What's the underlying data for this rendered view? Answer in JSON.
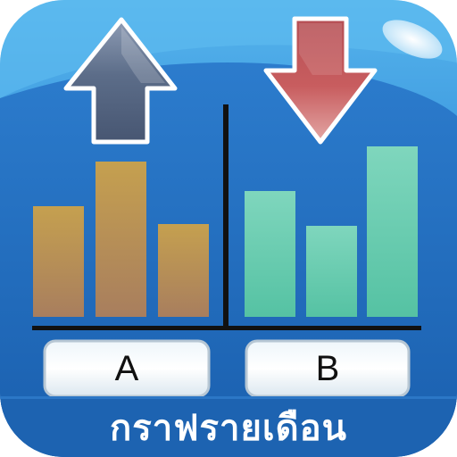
{
  "icon": {
    "caption": "กราฟรายเดือน",
    "group_a_label": "A",
    "group_b_label": "B",
    "arrow_up_name": "arrow-up-icon",
    "arrow_down_name": "arrow-down-icon"
  },
  "colors": {
    "background_light": "#3c9be0",
    "background_dark": "#1462b5",
    "caption_band": "#1c67b8",
    "group_a_bars": "#b98a55",
    "group_b_bars": "#6fd0b3",
    "arrow_up": "#5a6b86",
    "arrow_down": "#b84a4e",
    "divider": "#111111"
  }
}
